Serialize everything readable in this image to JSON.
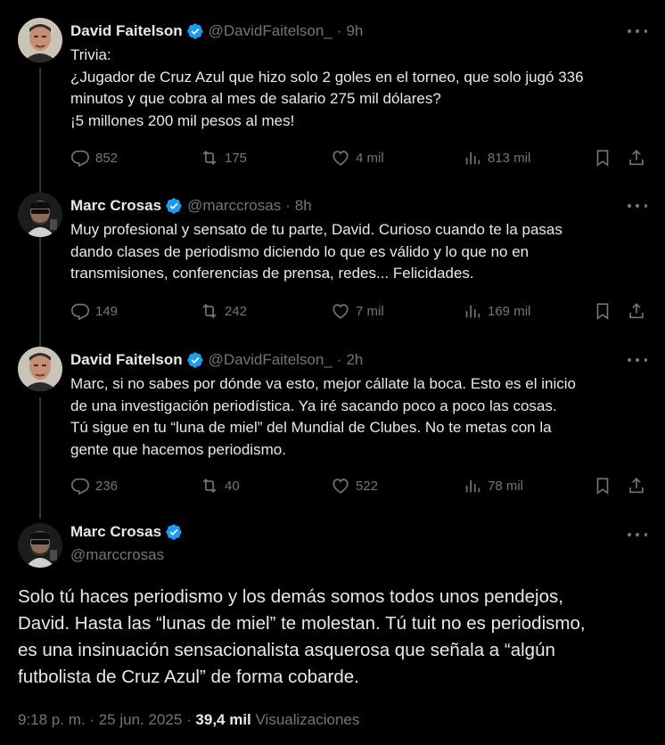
{
  "colors": {
    "background": "#000000",
    "text": "#e7e9ea",
    "secondary": "#71767b",
    "verified": "#1d9bf0",
    "thread_line": "#333639"
  },
  "tweets": [
    {
      "name": "David Faitelson",
      "handle": "@DavidFaitelson_",
      "time": "9h",
      "verified": true,
      "lines": [
        "Trivia:",
        "¿Jugador de Cruz Azul que hizo solo 2 goles en el torneo, que solo jugó 336",
        "minutos y que cobra al mes de salario 275 mil dólares?",
        "¡5 millones 200 mil pesos al mes!"
      ],
      "replies": "852",
      "reposts": "175",
      "likes": "4 mil",
      "views": "813 mil"
    },
    {
      "name": "Marc Crosas",
      "handle": "@marccrosas",
      "time": "8h",
      "verified": true,
      "lines": [
        "Muy profesional y sensato de tu parte, David. Curioso cuando te la pasas",
        "dando clases de periodismo diciendo lo que es válido y lo que no en",
        "transmisiones, conferencias de prensa, redes... Felicidades."
      ],
      "replies": "149",
      "reposts": "242",
      "likes": "7 mil",
      "views": "169 mil"
    },
    {
      "name": "David Faitelson",
      "handle": "@DavidFaitelson_",
      "time": "2h",
      "verified": true,
      "lines": [
        "Marc, si no sabes por dónde va esto, mejor cállate la boca. Esto es el inicio",
        "de una investigación periodística. Ya iré sacando poco a poco las cosas.",
        "Tú sigue en tu “luna de miel” del Mundial de Clubes. No te metas con la",
        "gente que hacemos periodismo."
      ],
      "replies": "236",
      "reposts": "40",
      "likes": "522",
      "views": "78 mil"
    }
  ],
  "main_tweet": {
    "name": "Marc Crosas",
    "handle": "@marccrosas",
    "verified": true,
    "lines": [
      "Solo tú haces periodismo y los demás somos todos unos pendejos,",
      "David. Hasta las “lunas de miel” te molestan. Tú tuit no es periodismo,",
      "es una insinuación sensacionalista asquerosa que señala a “algún",
      "futbolista de Cruz Azul” de forma cobarde."
    ],
    "timestamp": "9:18 p. m. · 25 jun. 2025 · ",
    "views_count": "39,4 mil",
    "views_label": " Visualizaciones"
  }
}
